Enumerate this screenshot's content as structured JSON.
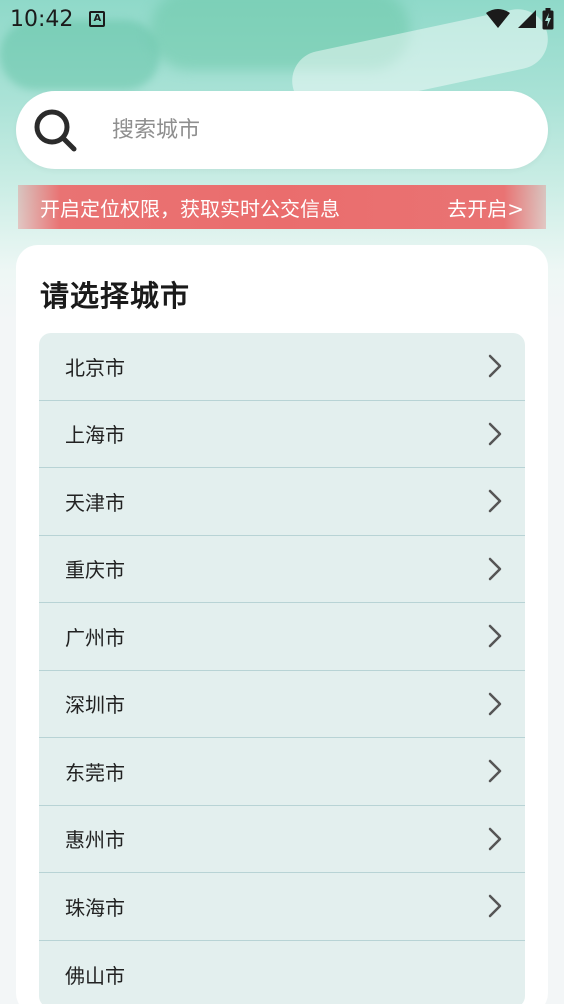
{
  "status_bar": {
    "time": "10:42",
    "notification_icon": "text-a-icon",
    "icons": [
      "wifi-icon",
      "signal-icon",
      "battery-charging-icon"
    ]
  },
  "search": {
    "placeholder": "搜索城市",
    "icon": "search-icon"
  },
  "location_banner": {
    "message": "开启定位权限，获取实时公交信息",
    "action_label": "去开启>",
    "color": "#ea6d6d"
  },
  "city_list": {
    "title": "请选择城市",
    "cities": [
      {
        "name": "北京市"
      },
      {
        "name": "上海市"
      },
      {
        "name": "天津市"
      },
      {
        "name": "重庆市"
      },
      {
        "name": "广州市"
      },
      {
        "name": "深圳市"
      },
      {
        "name": "东莞市"
      },
      {
        "name": "惠州市"
      },
      {
        "name": "珠海市"
      },
      {
        "name": "佛山市"
      }
    ]
  },
  "colors": {
    "accent_green": "#8fd9c9",
    "list_background": "#e3efee",
    "divider": "#b8d3d5"
  }
}
